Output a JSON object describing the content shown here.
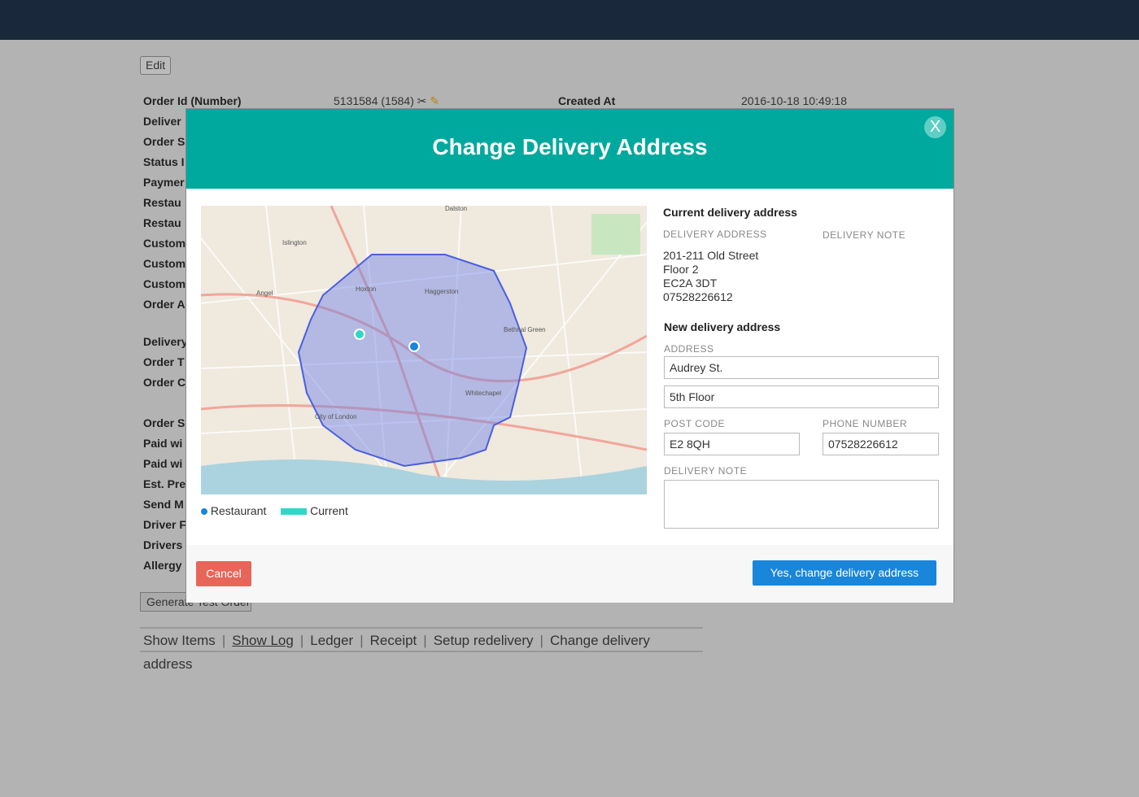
{
  "page": {
    "edit_label": "Edit",
    "generate_label": "Generate Test Order",
    "order_id_label": "Order Id (Number)",
    "order_id_value": "5131584 (1584)",
    "created_label": "Created At",
    "created_value": "2016-10-18 10:49:18",
    "labels": [
      "Deliver",
      "Order S",
      "Status I",
      "Paymer",
      "Restau",
      "Restau",
      "Custom",
      "Custom",
      "Custom",
      "Order A",
      "Delivery",
      "Order T",
      "Order C",
      "Order S",
      "Paid wi",
      "Paid wi",
      "Est. Pre",
      "Send M",
      "Driver F",
      "Drivers",
      "Allergy"
    ],
    "links": [
      "Show Items",
      "Show Log",
      "Ledger",
      "Receipt",
      "Setup redelivery",
      "Change delivery address"
    ]
  },
  "modal": {
    "title": "Change Delivery Address",
    "close": "X",
    "legend": {
      "restaurant": "Restaurant",
      "current": "Current",
      "restaurant_color": "#1a86d9",
      "current_color": "#33d6c6"
    },
    "current": {
      "heading": "Current delivery address",
      "address_caption": "DELIVERY ADDRESS",
      "note_caption": "DELIVERY NOTE",
      "lines": [
        "201-211 Old Street",
        "Floor 2",
        "EC2A 3DT",
        "07528226612"
      ]
    },
    "new": {
      "heading": "New delivery address",
      "address_caption": "ADDRESS",
      "address1": "Audrey St.",
      "address2": "5th Floor",
      "postcode_caption": "POST CODE",
      "postcode": "E2 8QH",
      "phone_caption": "PHONE NUMBER",
      "phone": "07528226612",
      "note_caption": "DELIVERY NOTE",
      "note": ""
    },
    "cancel": "Cancel",
    "confirm": "Yes, change delivery address",
    "map_labels": [
      "Dalston",
      "Angel",
      "Hoxton",
      "Haggerston",
      "Whitechapel",
      "City of London",
      "Bethnal Green",
      "Islington"
    ]
  }
}
